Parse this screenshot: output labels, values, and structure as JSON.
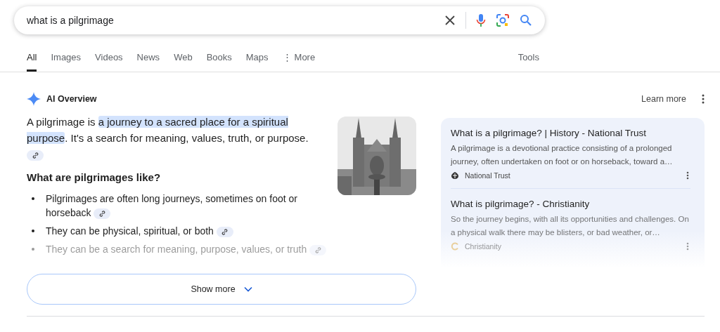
{
  "search": {
    "value": "what is a pilgrimage"
  },
  "tabs": [
    {
      "label": "All",
      "selected": true
    },
    {
      "label": "Images",
      "selected": false
    },
    {
      "label": "Videos",
      "selected": false
    },
    {
      "label": "News",
      "selected": false
    },
    {
      "label": "Web",
      "selected": false
    },
    {
      "label": "Books",
      "selected": false
    },
    {
      "label": "Maps",
      "selected": false
    },
    {
      "label": "More",
      "selected": false,
      "kind": "menu",
      "icon": "⋮"
    }
  ],
  "tools": "Tools",
  "overview": {
    "title": "AI Overview",
    "learn_more": "Learn more",
    "intro": {
      "before": "A pilgrimage is ",
      "highlight": "a journey to a sacred place for a spiritual purpose",
      "after": ". It's a search for meaning, values, truth, or purpose."
    },
    "heading": "What are pilgrimages like?",
    "bullets": [
      {
        "text": "Pilgrimages are often long journeys, sometimes on foot or horseback",
        "faded": false
      },
      {
        "text": "They can be physical, spiritual, or both",
        "faded": false
      },
      {
        "text": "They can be a search for meaning, purpose, values, or truth",
        "faded": true
      }
    ],
    "sources": [
      {
        "title": "What is a pilgrimage? | History - National Trust",
        "snippet": "A pilgrimage is a devotional practice consisting of a prolonged journey, often undertaken on foot or on horseback, toward a…",
        "site": "National Trust",
        "faded": false
      },
      {
        "title": "What is pilgrimage? - Christianity",
        "snippet": "So the journey begins, with all its opportunities and challenges. On a physical walk there may be blisters, or bad weather, or…",
        "site": "Christianity",
        "faded": true
      }
    ],
    "show_more": "Show more"
  }
}
